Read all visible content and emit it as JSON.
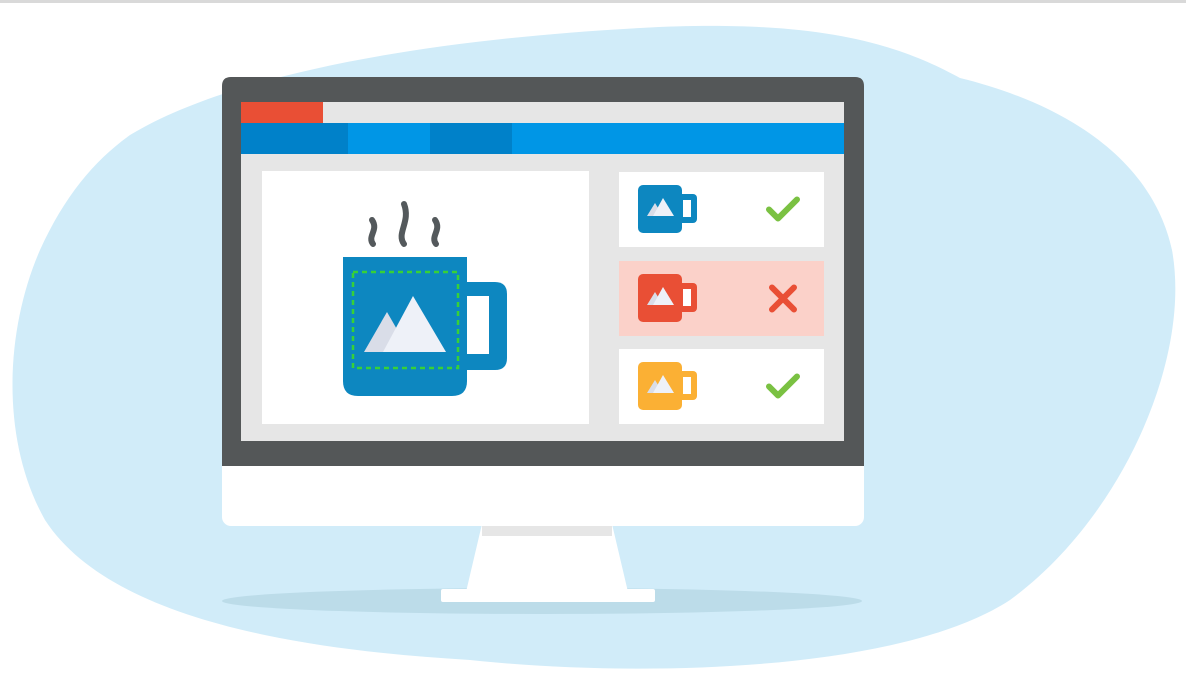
{
  "colors": {
    "page_background": "#ffffff",
    "top_border": "#d9d9d9",
    "blob": "#d1ecf9",
    "monitor_frame": "#545758",
    "monitor_chin": "#ffffff",
    "stand": "#ffffff",
    "stand_neck_shade": "#e6e6e6",
    "floor_shadow": "#bcdce9",
    "screen_background": "#e6e6e6",
    "browser_tab_bar": "#e6e6e6",
    "browser_active_tab": "#e94f35",
    "browser_nav_bar": "#0096e6",
    "browser_nav_segment_dark": "#0081c9",
    "panel_background": "#ffffff",
    "mug_blue": "#0d87c0",
    "mug_red": "#e94f35",
    "mug_yellow": "#fbb034",
    "mug_handle_hole": "#ffffff",
    "mountain_front": "#eef1f8",
    "mountain_back": "#d9dde8",
    "steam": "#54595c",
    "selection_outline": "#37d137",
    "check_green": "#7ac142",
    "cross_red": "#e94f35",
    "rejected_row_background": "#fbd1c9"
  },
  "illustration": {
    "monitor": {
      "browser": {
        "tab_bar": {
          "active_tab_icon": "active-tab-marker"
        },
        "nav_bar": {
          "segments_icon": "nav-segment"
        }
      },
      "preview_panel": {
        "mug_icon": "coffee-mug-icon",
        "steam_icon": "steam-icon",
        "image_icon": "mountain-image-icon",
        "selection_icon": "dashed-selection-outline"
      },
      "results": [
        {
          "mug_color": "blue",
          "status": "approved",
          "status_icon": "check-icon"
        },
        {
          "mug_color": "red",
          "status": "rejected",
          "status_icon": "cross-icon"
        },
        {
          "mug_color": "yellow",
          "status": "approved",
          "status_icon": "check-icon"
        }
      ]
    }
  }
}
